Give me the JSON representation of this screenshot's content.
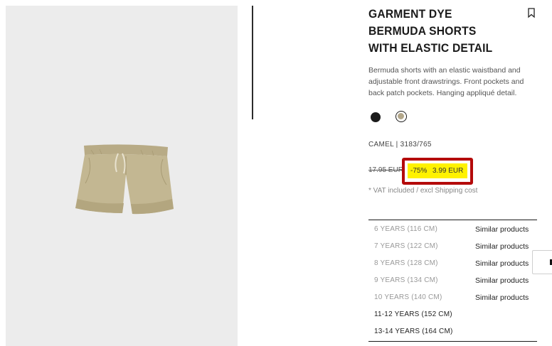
{
  "product": {
    "title": "GARMENT DYE BERMUDA SHORTS WITH ELASTIC DETAIL",
    "description": "Bermuda shorts with an elastic waistband and adjustable front drawstrings. Front pockets and back patch pockets. Hanging appliqué detail.",
    "colors": [
      {
        "name": "black",
        "hex": "#1b1b1b",
        "selected": false
      },
      {
        "name": "camel",
        "hex": "#b3a78a",
        "selected": true
      }
    ],
    "reference": "CAMEL | 3183/765",
    "old_price": "17.95 EUR",
    "discount": "-75%",
    "new_price": "3.99 EUR",
    "vat_note": "* VAT included / excl Shipping cost",
    "highlight_color": "#b40a0a",
    "price_bg_color": "#fff200"
  },
  "sizes": [
    {
      "label": "6 YEARS (116 CM)",
      "available": false,
      "action": "Similar products"
    },
    {
      "label": "7 YEARS (122 CM)",
      "available": false,
      "action": "Similar products"
    },
    {
      "label": "8 YEARS (128 CM)",
      "available": false,
      "action": "Similar products"
    },
    {
      "label": "9 YEARS (134 CM)",
      "available": false,
      "action": "Similar products"
    },
    {
      "label": "10 YEARS (140 CM)",
      "available": false,
      "action": "Similar products"
    },
    {
      "label": "11-12 YEARS (152 CM)",
      "available": true,
      "action": ""
    },
    {
      "label": "13-14 YEARS (164 CM)",
      "available": true,
      "action": ""
    }
  ],
  "icons": {
    "bookmark": "bookmark-icon",
    "side_tab": "side-tab-icon"
  }
}
